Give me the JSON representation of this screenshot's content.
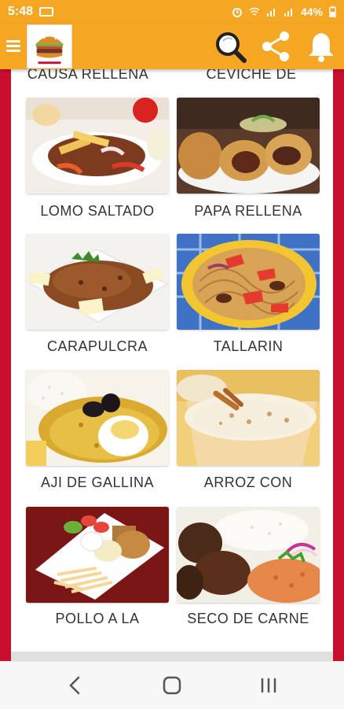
{
  "status_bar": {
    "time": "5:48",
    "battery": "44%"
  },
  "app_bar": {
    "menu_icon": "menu-icon",
    "logo_icon": "burger-logo",
    "search_icon": "search-icon",
    "share_icon": "share-icon",
    "notification_icon": "bell-icon"
  },
  "dishes": [
    {
      "label": "CAUSA RELLENA"
    },
    {
      "label": "CEVICHE DE"
    },
    {
      "label": "LOMO SALTADO"
    },
    {
      "label": "PAPA RELLENA"
    },
    {
      "label": "CARAPULCRA"
    },
    {
      "label": "TALLARIN"
    },
    {
      "label": "AJI DE GALLINA"
    },
    {
      "label": "ARROZ CON"
    },
    {
      "label": "POLLO A LA"
    },
    {
      "label": "SECO DE CARNE"
    }
  ],
  "colors": {
    "accent": "#f5a623",
    "side_bars": "#c8102e"
  },
  "nav_bar": {
    "back_icon": "back-icon",
    "home_icon": "home-icon",
    "recents_icon": "recents-icon"
  }
}
